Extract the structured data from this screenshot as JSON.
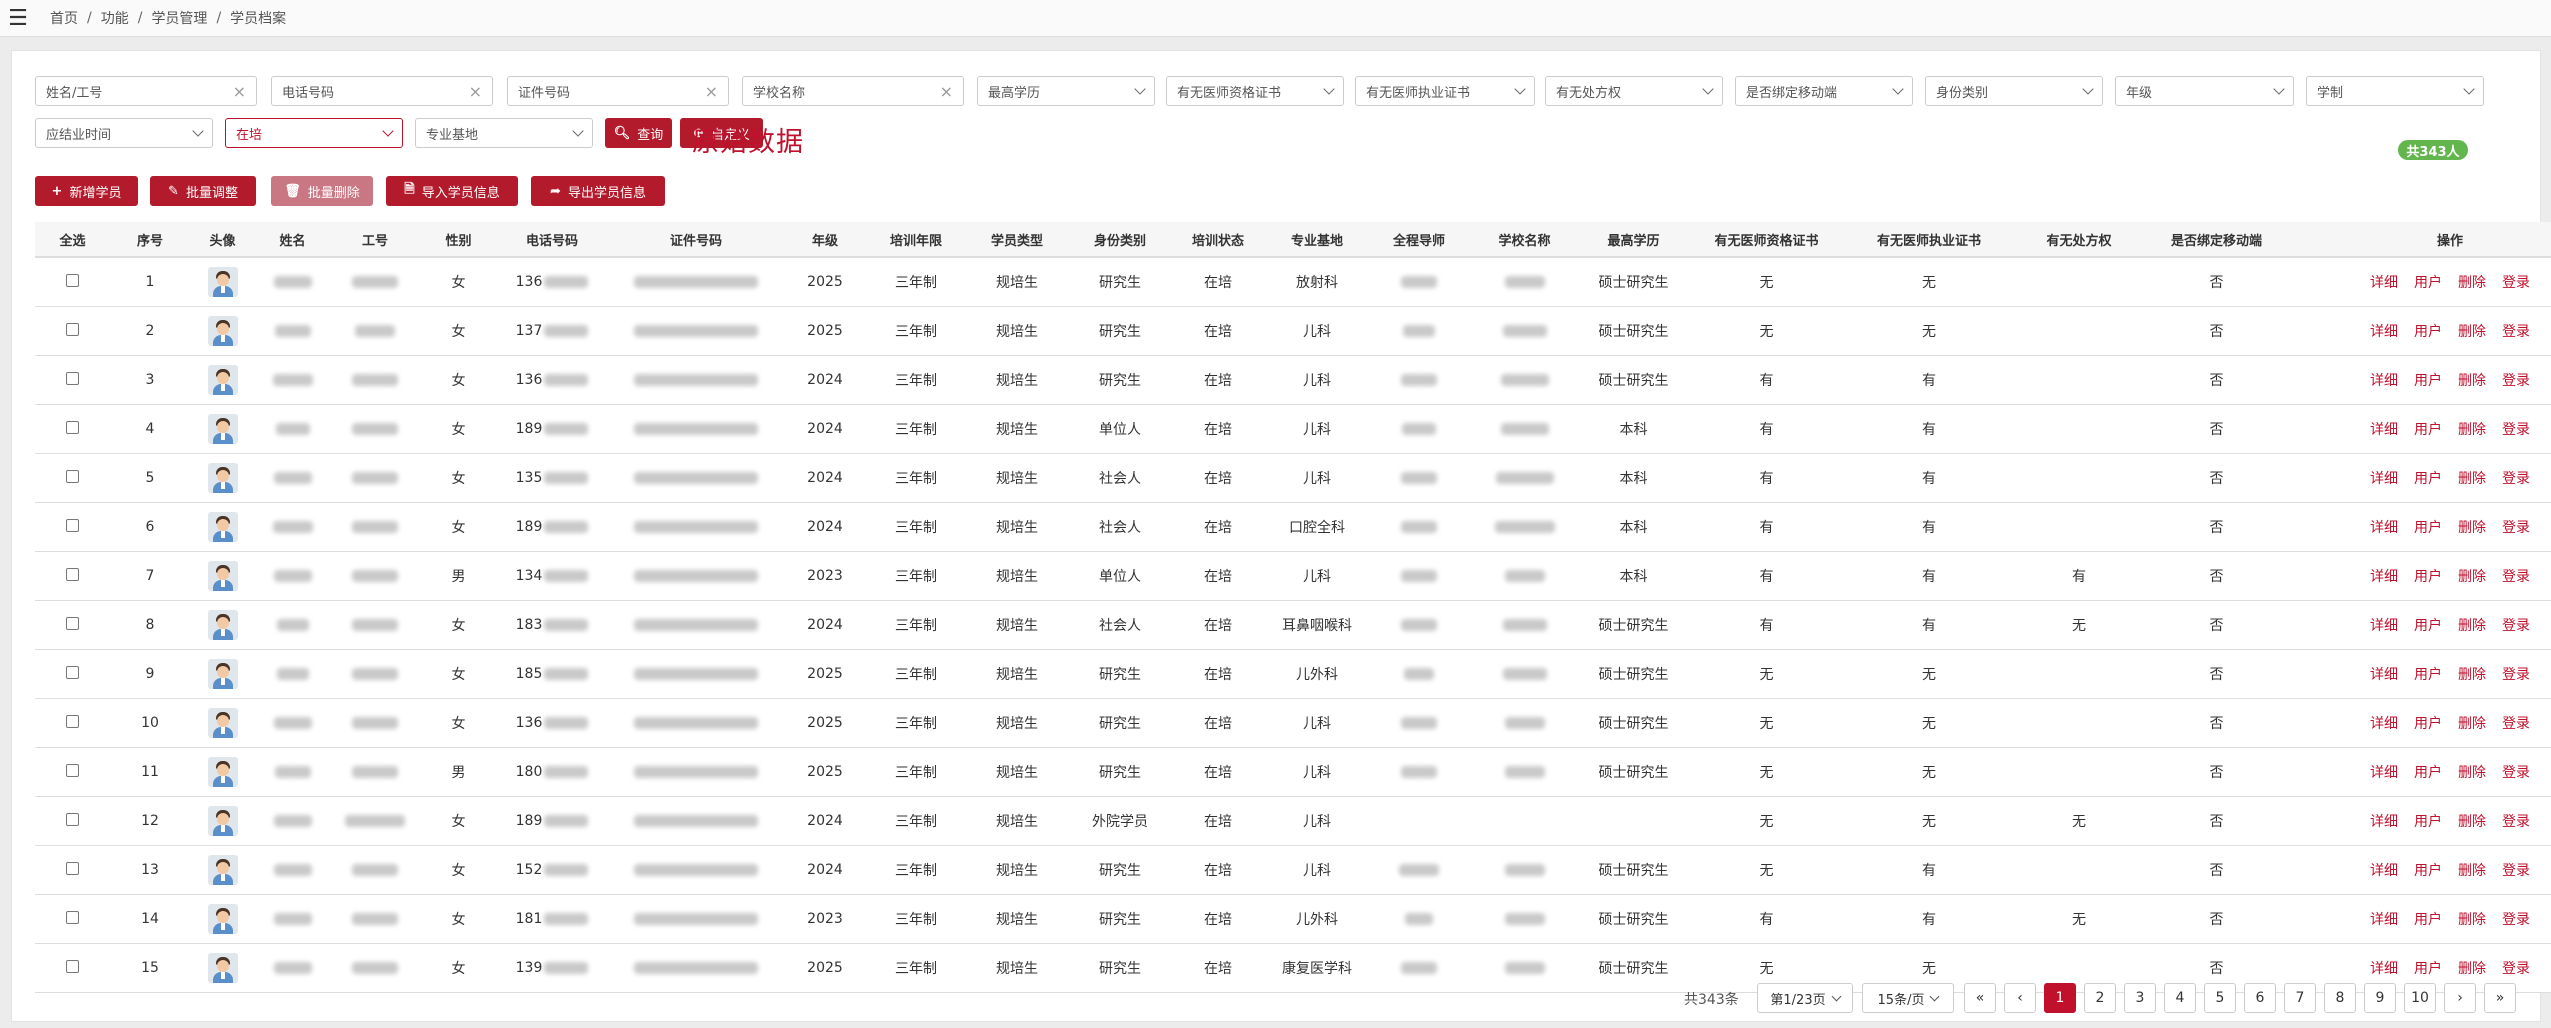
{
  "breadcrumb": [
    "首页",
    "功能",
    "学员管理",
    "学员档案"
  ],
  "filters_row1": [
    {
      "label": "姓名/工号",
      "kind": "text"
    },
    {
      "label": "电话号码",
      "kind": "text"
    },
    {
      "label": "证件号码",
      "kind": "text"
    },
    {
      "label": "学校名称",
      "kind": "text"
    },
    {
      "label": "最高学历",
      "kind": "select"
    },
    {
      "label": "有无医师资格证书",
      "kind": "select"
    },
    {
      "label": "有无医师执业证书",
      "kind": "select"
    },
    {
      "label": "有无处方权",
      "kind": "select"
    },
    {
      "label": "是否绑定移动端",
      "kind": "select"
    },
    {
      "label": "身份类别",
      "kind": "select"
    },
    {
      "label": "年级",
      "kind": "select"
    },
    {
      "label": "学制",
      "kind": "select"
    }
  ],
  "filters_row2": [
    {
      "label": "应结业时间",
      "kind": "select"
    },
    {
      "label": "在培",
      "kind": "select-active"
    },
    {
      "label": "专业基地",
      "kind": "select"
    }
  ],
  "search_buttons": {
    "query": "查询",
    "custom": "自定义"
  },
  "actions": {
    "add": "新增学员",
    "batch_adjust": "批量调整",
    "batch_delete": "批量删除",
    "import": "导入学员信息",
    "export": "导出学员信息"
  },
  "raw_data_label": "原始数据",
  "total_badge": "共343人",
  "table": {
    "headers": [
      "全选",
      "序号",
      "头像",
      "姓名",
      "工号",
      "性别",
      "电话号码",
      "证件号码",
      "年级",
      "培训年限",
      "学员类型",
      "身份类别",
      "培训状态",
      "专业基地",
      "全程导师",
      "学校名称",
      "最高学历",
      "有无医师资格证书",
      "有无医师执业证书",
      "有无处方权",
      "是否绑定移动端",
      "操作"
    ],
    "row_actions": [
      "详细",
      "用户",
      "删除",
      "登录"
    ],
    "rows": [
      {
        "no": "1",
        "gender": "女",
        "phone": "136",
        "grade": "2025",
        "years": "三年制",
        "type": "规培生",
        "identity": "研究生",
        "status": "在培",
        "base": "放射科",
        "degree": "硕士研究生",
        "qual": "无",
        "lic": "无",
        "rx": "",
        "mobile": "否"
      },
      {
        "no": "2",
        "gender": "女",
        "phone": "137",
        "grade": "2025",
        "years": "三年制",
        "type": "规培生",
        "identity": "研究生",
        "status": "在培",
        "base": "儿科",
        "degree": "硕士研究生",
        "qual": "无",
        "lic": "无",
        "rx": "",
        "mobile": "否"
      },
      {
        "no": "3",
        "gender": "女",
        "phone": "136",
        "grade": "2024",
        "years": "三年制",
        "type": "规培生",
        "identity": "研究生",
        "status": "在培",
        "base": "儿科",
        "degree": "硕士研究生",
        "qual": "有",
        "lic": "有",
        "rx": "",
        "mobile": "否"
      },
      {
        "no": "4",
        "gender": "女",
        "phone": "189",
        "grade": "2024",
        "years": "三年制",
        "type": "规培生",
        "identity": "单位人",
        "status": "在培",
        "base": "儿科",
        "degree": "本科",
        "qual": "有",
        "lic": "有",
        "rx": "",
        "mobile": "否"
      },
      {
        "no": "5",
        "gender": "女",
        "phone": "135",
        "grade": "2024",
        "years": "三年制",
        "type": "规培生",
        "identity": "社会人",
        "status": "在培",
        "base": "儿科",
        "degree": "本科",
        "qual": "有",
        "lic": "有",
        "rx": "",
        "mobile": "否"
      },
      {
        "no": "6",
        "gender": "女",
        "phone": "189",
        "grade": "2024",
        "years": "三年制",
        "type": "规培生",
        "identity": "社会人",
        "status": "在培",
        "base": "口腔全科",
        "degree": "本科",
        "qual": "有",
        "lic": "有",
        "rx": "",
        "mobile": "否"
      },
      {
        "no": "7",
        "gender": "男",
        "phone": "134",
        "grade": "2023",
        "years": "三年制",
        "type": "规培生",
        "identity": "单位人",
        "status": "在培",
        "base": "儿科",
        "degree": "本科",
        "qual": "有",
        "lic": "有",
        "rx": "有",
        "mobile": "否"
      },
      {
        "no": "8",
        "gender": "女",
        "phone": "183",
        "grade": "2024",
        "years": "三年制",
        "type": "规培生",
        "identity": "社会人",
        "status": "在培",
        "base": "耳鼻咽喉科",
        "degree": "硕士研究生",
        "qual": "有",
        "lic": "有",
        "rx": "无",
        "mobile": "否"
      },
      {
        "no": "9",
        "gender": "女",
        "phone": "185",
        "grade": "2025",
        "years": "三年制",
        "type": "规培生",
        "identity": "研究生",
        "status": "在培",
        "base": "儿外科",
        "degree": "硕士研究生",
        "qual": "无",
        "lic": "无",
        "rx": "",
        "mobile": "否"
      },
      {
        "no": "10",
        "gender": "女",
        "phone": "136",
        "grade": "2025",
        "years": "三年制",
        "type": "规培生",
        "identity": "研究生",
        "status": "在培",
        "base": "儿科",
        "degree": "硕士研究生",
        "qual": "无",
        "lic": "无",
        "rx": "",
        "mobile": "否"
      },
      {
        "no": "11",
        "gender": "男",
        "phone": "180",
        "grade": "2025",
        "years": "三年制",
        "type": "规培生",
        "identity": "研究生",
        "status": "在培",
        "base": "儿科",
        "degree": "硕士研究生",
        "qual": "无",
        "lic": "无",
        "rx": "",
        "mobile": "否"
      },
      {
        "no": "12",
        "gender": "女",
        "phone": "189",
        "grade": "2024",
        "years": "三年制",
        "type": "规培生",
        "identity": "外院学员",
        "status": "在培",
        "base": "儿科",
        "degree": "",
        "qual": "无",
        "lic": "无",
        "rx": "无",
        "mobile": "否"
      },
      {
        "no": "13",
        "gender": "女",
        "phone": "152",
        "grade": "2024",
        "years": "三年制",
        "type": "规培生",
        "identity": "研究生",
        "status": "在培",
        "base": "儿科",
        "degree": "硕士研究生",
        "qual": "无",
        "lic": "有",
        "rx": "",
        "mobile": "否"
      },
      {
        "no": "14",
        "gender": "女",
        "phone": "181",
        "grade": "2023",
        "years": "三年制",
        "type": "规培生",
        "identity": "研究生",
        "status": "在培",
        "base": "儿外科",
        "degree": "硕士研究生",
        "qual": "有",
        "lic": "有",
        "rx": "无",
        "mobile": "否"
      },
      {
        "no": "15",
        "gender": "女",
        "phone": "139",
        "grade": "2025",
        "years": "三年制",
        "type": "规培生",
        "identity": "研究生",
        "status": "在培",
        "base": "康复医学科",
        "degree": "硕士研究生",
        "qual": "无",
        "lic": "无",
        "rx": "",
        "mobile": "否"
      }
    ]
  },
  "pagination": {
    "total": "共343条",
    "page_select": "第1/23页",
    "size_select": "15条/页",
    "first": "«",
    "prev": "‹",
    "pages": [
      "1",
      "2",
      "3",
      "4",
      "5",
      "6",
      "7",
      "8",
      "9",
      "10"
    ],
    "next": "›",
    "last": "»"
  },
  "colors": {
    "accent": "#b31a2c",
    "link": "#c0102c",
    "badge": "#63b54e"
  }
}
